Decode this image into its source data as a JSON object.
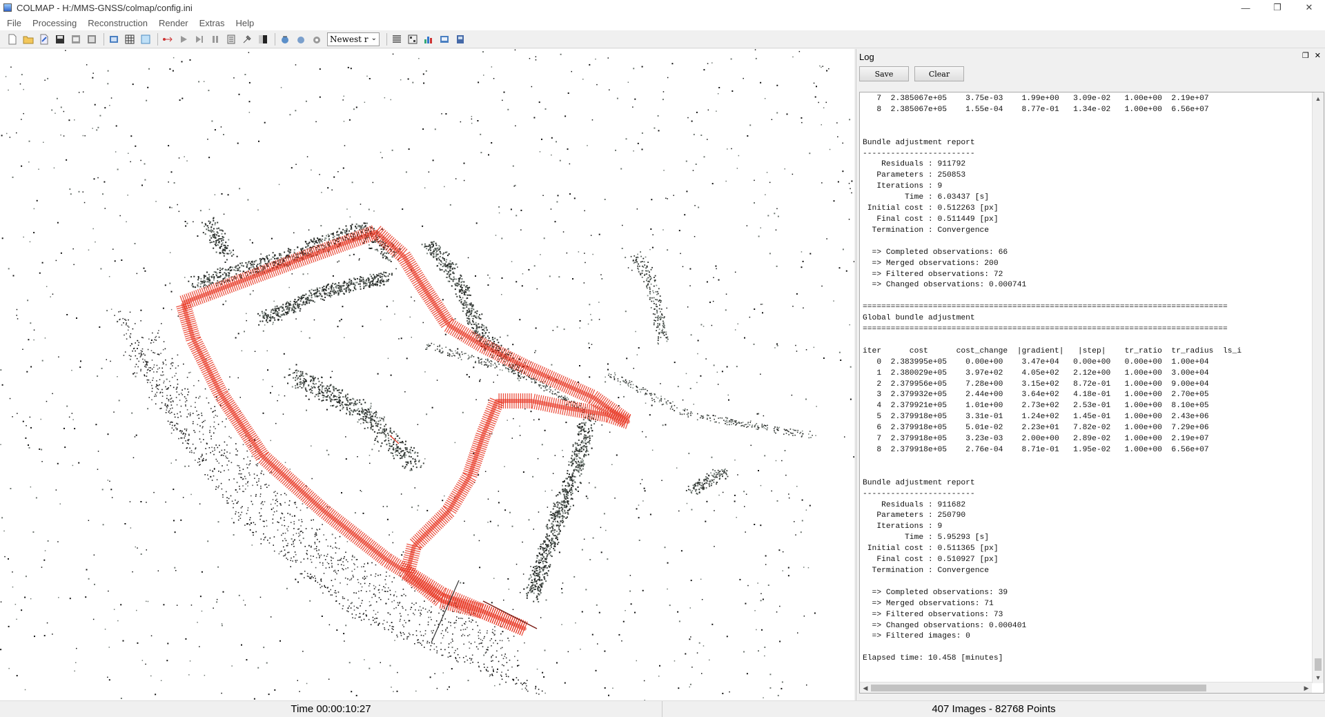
{
  "window": {
    "title": "COLMAP - H:/MMS-GNSS/colmap/config.ini",
    "controls": [
      "—",
      "❐",
      "✕"
    ]
  },
  "menu": [
    "File",
    "Processing",
    "Reconstruction",
    "Render",
    "Extras",
    "Help"
  ],
  "toolbar": {
    "select_value": "Newest r"
  },
  "log": {
    "title": "Log",
    "save_label": "Save",
    "clear_label": "Clear",
    "lines": [
      "   7  2.385067e+05    3.75e-03    1.99e+00   3.09e-02   1.00e+00  2.19e+07",
      "   8  2.385067e+05    1.55e-04    8.77e-01   1.34e-02   1.00e+00  6.56e+07",
      "",
      "",
      "Bundle adjustment report",
      "------------------------",
      "    Residuals : 911792",
      "   Parameters : 250853",
      "   Iterations : 9",
      "         Time : 6.03437 [s]",
      " Initial cost : 0.512263 [px]",
      "   Final cost : 0.511449 [px]",
      "  Termination : Convergence",
      "",
      "  => Completed observations: 66",
      "  => Merged observations: 200",
      "  => Filtered observations: 72",
      "  => Changed observations: 0.000741",
      "",
      "==============================================================================",
      "Global bundle adjustment",
      "==============================================================================",
      "",
      "iter      cost      cost_change  |gradient|   |step|    tr_ratio  tr_radius  ls_i",
      "   0  2.383995e+05    0.00e+00    3.47e+04   0.00e+00   0.00e+00  1.00e+04",
      "   1  2.380029e+05    3.97e+02    4.05e+02   2.12e+00   1.00e+00  3.00e+04",
      "   2  2.379956e+05    7.28e+00    3.15e+02   8.72e-01   1.00e+00  9.00e+04",
      "   3  2.379932e+05    2.44e+00    3.64e+02   4.18e-01   1.00e+00  2.70e+05",
      "   4  2.379921e+05    1.01e+00    2.73e+02   2.53e-01   1.00e+00  8.10e+05",
      "   5  2.379918e+05    3.31e-01    1.24e+02   1.45e-01   1.00e+00  2.43e+06",
      "   6  2.379918e+05    5.01e-02    2.23e+01   7.82e-02   1.00e+00  7.29e+06",
      "   7  2.379918e+05    3.23e-03    2.00e+00   2.89e-02   1.00e+00  2.19e+07",
      "   8  2.379918e+05    2.76e-04    8.71e-01   1.95e-02   1.00e+00  6.56e+07",
      "",
      "",
      "Bundle adjustment report",
      "------------------------",
      "    Residuals : 911682",
      "   Parameters : 250790",
      "   Iterations : 9",
      "         Time : 5.95293 [s]",
      " Initial cost : 0.511365 [px]",
      "   Final cost : 0.510927 [px]",
      "  Termination : Convergence",
      "",
      "  => Completed observations: 39",
      "  => Merged observations: 71",
      "  => Filtered observations: 73",
      "  => Changed observations: 0.000401",
      "  => Filtered images: 0",
      "",
      "Elapsed time: 10.458 [minutes]"
    ]
  },
  "status": {
    "time": "Time 00:00:10:27",
    "summary": "407 Images - 82768 Points"
  },
  "colors": {
    "camera_trajectory": "#e8321e",
    "point_dark": "#3a3f3a",
    "point_gray": "#6d7570"
  }
}
